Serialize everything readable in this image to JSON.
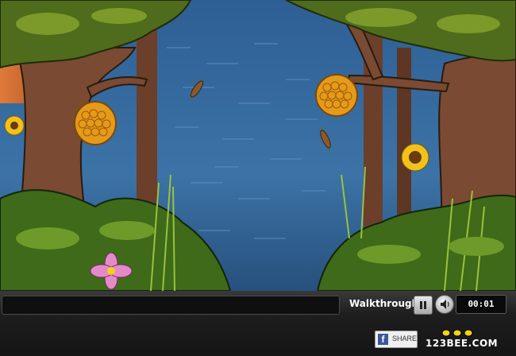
{
  "scene": {
    "name": "jungle-waterfall-scene",
    "colors": {
      "sky": "#2d5b8e",
      "foliage": "#4a6e1e",
      "trunk": "#7a4a32",
      "honey": "#e59a1a"
    }
  },
  "toolbar": {
    "walkthrough_label": "Walkthrough",
    "pause_icon": "pause-icon",
    "sound_icon": "speaker-icon",
    "timer": "00:01"
  },
  "footer": {
    "share_label": "SHARE",
    "share_icon": "facebook-icon",
    "logo_text": "123BEE.COM"
  }
}
